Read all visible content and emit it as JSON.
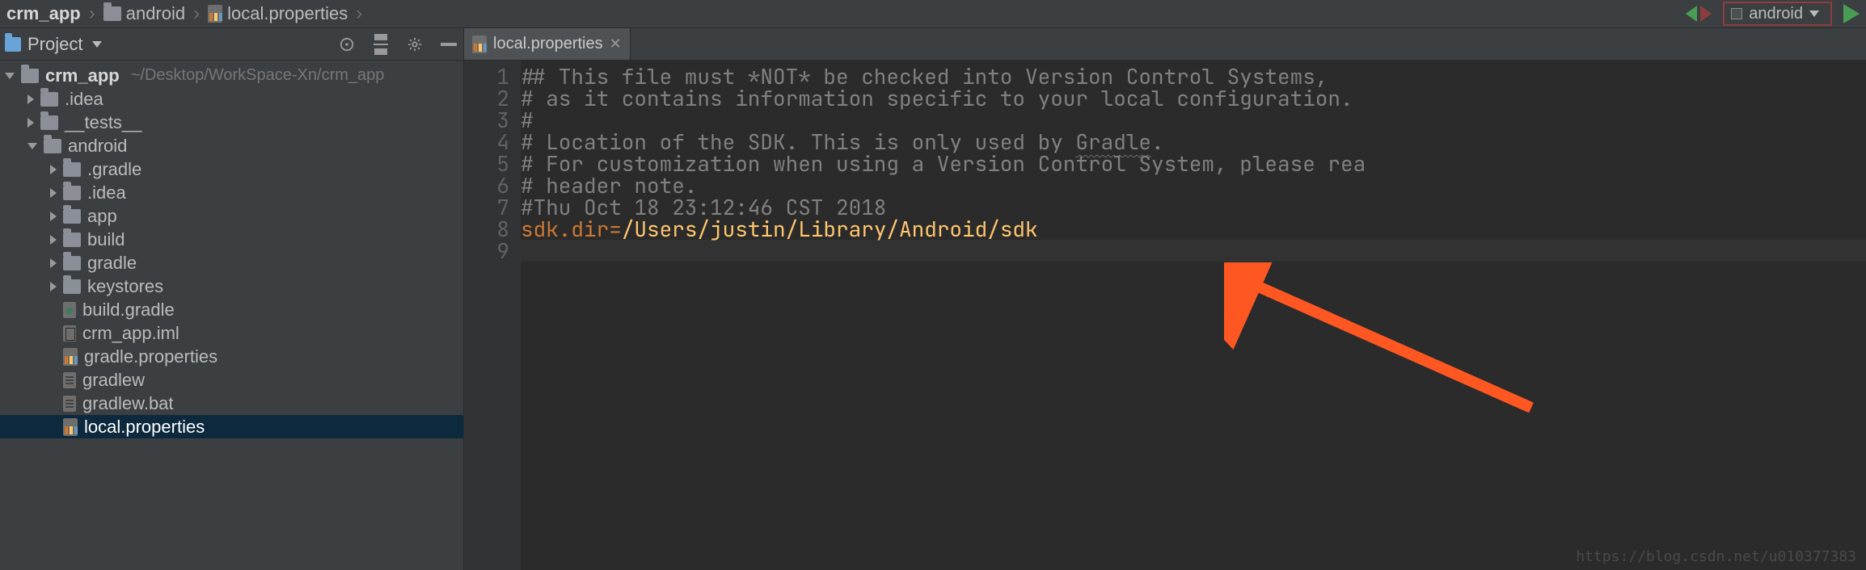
{
  "breadcrumbs": [
    "crm_app",
    "android",
    "local.properties"
  ],
  "top": {
    "device_label": "android"
  },
  "sidebar": {
    "tool_window_title": "Project",
    "root_name": "crm_app",
    "root_path": "~/Desktop/WorkSpace-Xn/crm_app",
    "tree": [
      {
        "indent": 1,
        "type": "folder",
        "expander": "collapsed",
        "label": ".idea"
      },
      {
        "indent": 1,
        "type": "folder",
        "expander": "collapsed",
        "label": "__tests__"
      },
      {
        "indent": 1,
        "type": "folder",
        "expander": "expanded",
        "label": "android"
      },
      {
        "indent": 2,
        "type": "folder",
        "expander": "collapsed",
        "label": ".gradle"
      },
      {
        "indent": 2,
        "type": "folder",
        "expander": "collapsed",
        "label": ".idea"
      },
      {
        "indent": 2,
        "type": "folder",
        "expander": "collapsed",
        "label": "app"
      },
      {
        "indent": 2,
        "type": "folder",
        "expander": "collapsed",
        "label": "build"
      },
      {
        "indent": 2,
        "type": "folder",
        "expander": "collapsed",
        "label": "gradle"
      },
      {
        "indent": 2,
        "type": "folder",
        "expander": "collapsed",
        "label": "keystores"
      },
      {
        "indent": 2,
        "type": "file",
        "icon": "gradle",
        "label": "build.gradle"
      },
      {
        "indent": 2,
        "type": "file",
        "icon": "iml",
        "label": "crm_app.iml"
      },
      {
        "indent": 2,
        "type": "file",
        "icon": "prop",
        "label": "gradle.properties"
      },
      {
        "indent": 2,
        "type": "file",
        "icon": "text",
        "label": "gradlew"
      },
      {
        "indent": 2,
        "type": "file",
        "icon": "text",
        "label": "gradlew.bat"
      },
      {
        "indent": 2,
        "type": "file",
        "icon": "prop",
        "label": "local.properties",
        "selected": true
      }
    ]
  },
  "editor": {
    "tab_label": "local.properties",
    "lines": [
      {
        "n": 1,
        "segments": [
          {
            "cls": "comment",
            "text": "## This file must *NOT* be checked into Version Control Systems,"
          }
        ]
      },
      {
        "n": 2,
        "segments": [
          {
            "cls": "comment",
            "text": "# as it contains information specific to your local configuration."
          }
        ]
      },
      {
        "n": 3,
        "segments": [
          {
            "cls": "comment",
            "text": "#"
          }
        ]
      },
      {
        "n": 4,
        "segments": [
          {
            "cls": "comment",
            "text": "# Location of the SDK. This is only used by "
          },
          {
            "cls": "comment under",
            "text": "Gradle"
          },
          {
            "cls": "comment",
            "text": "."
          }
        ]
      },
      {
        "n": 5,
        "segments": [
          {
            "cls": "comment",
            "text": "# For customization when using a Version Control System, please rea"
          }
        ]
      },
      {
        "n": 6,
        "segments": [
          {
            "cls": "comment",
            "text": "# header note."
          }
        ]
      },
      {
        "n": 7,
        "segments": [
          {
            "cls": "comment",
            "text": "#Thu Oct 18 23:12:46 CST 2018"
          }
        ]
      },
      {
        "n": 8,
        "segments": [
          {
            "cls": "prop-key",
            "text": "sdk.dir"
          },
          {
            "cls": "op",
            "text": "="
          },
          {
            "cls": "prop-val",
            "text": "/Users/justin/Library/Android/sdk"
          }
        ]
      },
      {
        "n": 9,
        "segments": []
      }
    ]
  },
  "watermark": "https://blog.csdn.net/u010377383"
}
